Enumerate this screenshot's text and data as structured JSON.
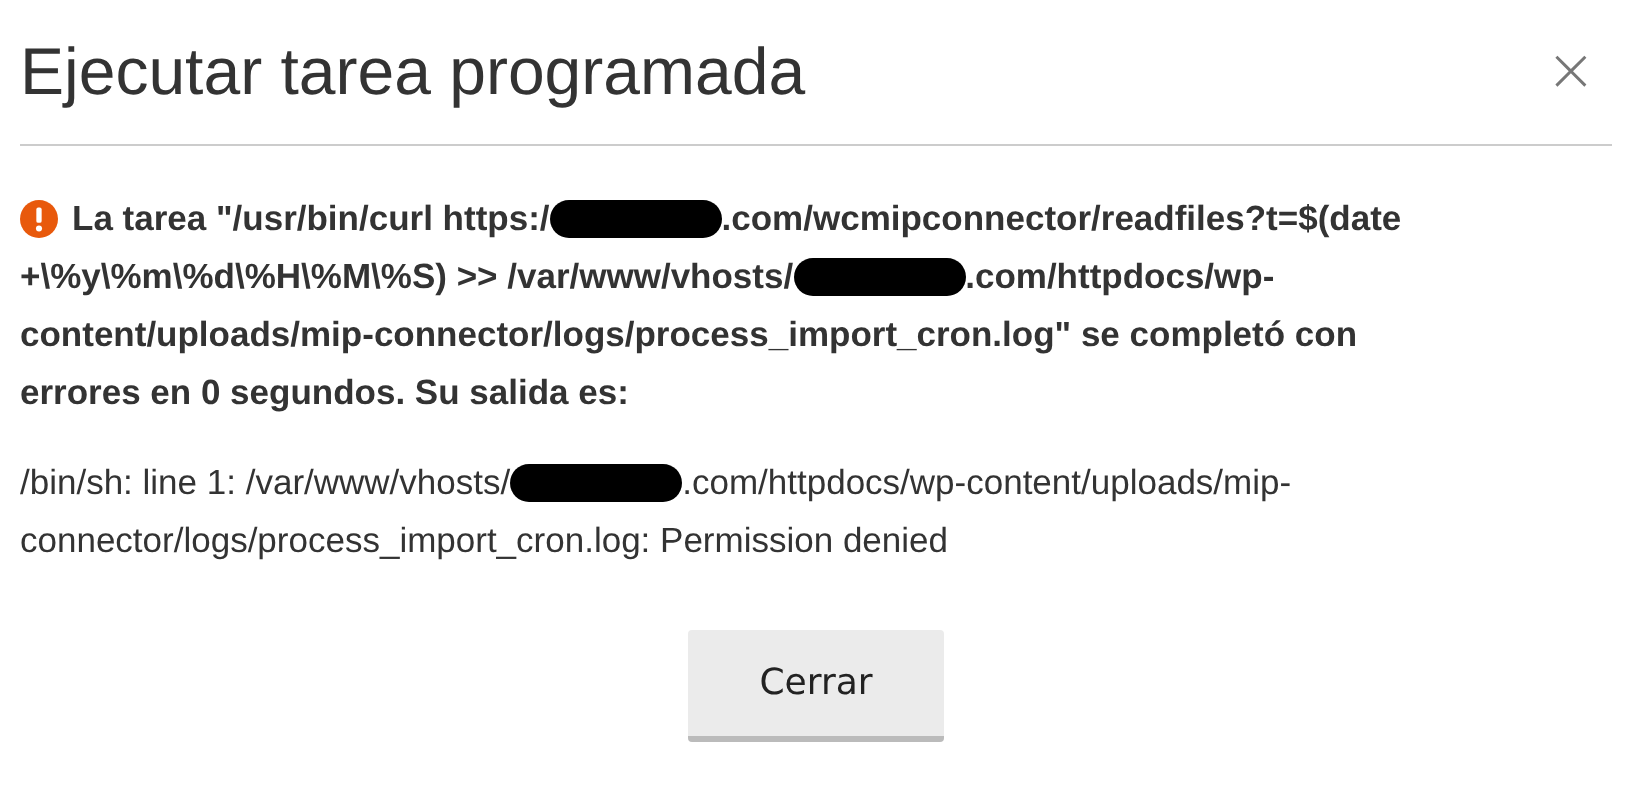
{
  "dialog": {
    "title": "Ejecutar tarea programada",
    "close": "×",
    "message": [
      [
        {
          "kind": "text",
          "text": "La tarea \"/usr/bin/curl https:/"
        },
        {
          "kind": "redaction"
        },
        {
          "kind": "text",
          "text": ".com/wcmipconnector/readfiles?t=$(date"
        }
      ],
      [
        {
          "kind": "text",
          "text": "+\\%y\\%m\\%d\\%H\\%M\\%S) >> /var/www/vhosts/"
        },
        {
          "kind": "redaction"
        },
        {
          "kind": "text",
          "text": ".com/httpdocs/wp-"
        }
      ],
      [
        {
          "kind": "text",
          "text": "content/uploads/mip-connector/logs/process_import_cron.log\" se completó con"
        }
      ],
      [
        {
          "kind": "text",
          "text": "errores en 0 segundos. Su salida es:"
        }
      ]
    ],
    "output": [
      [
        {
          "kind": "text",
          "text": "/bin/sh: line 1: /var/www/vhosts/"
        },
        {
          "kind": "redaction"
        },
        {
          "kind": "text",
          "text": ".com/httpdocs/wp-content/uploads/mip-"
        }
      ],
      [
        {
          "kind": "text",
          "text": "connector/logs/process_import_cron.log: Permission denied"
        }
      ]
    ],
    "buttons": [
      {
        "label": "Cerrar"
      }
    ]
  }
}
